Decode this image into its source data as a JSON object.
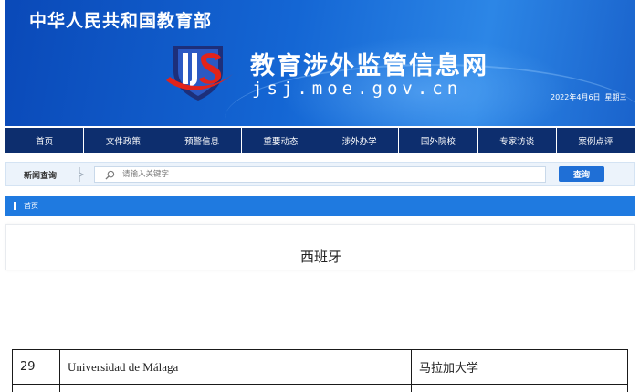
{
  "header": {
    "ministry": "中华人民共和国教育部",
    "site_title": "教育涉外监管信息网",
    "site_domain": "jsj.moe.gov.cn",
    "date": "2022年4月6日",
    "weekday": "星期三",
    "logo_icon": "jsj-shield-logo-icon",
    "colors": {
      "banner": "#1466d4",
      "logo_red": "#e2231a",
      "logo_navy": "#1d2f7a"
    }
  },
  "nav": {
    "items": [
      {
        "label": "首页"
      },
      {
        "label": "文件政策"
      },
      {
        "label": "预警信息"
      },
      {
        "label": "重要动态"
      },
      {
        "label": "涉外办学"
      },
      {
        "label": "国外院校"
      },
      {
        "label": "专家访谈"
      },
      {
        "label": "案例点评"
      }
    ],
    "color": "#0d2e6e"
  },
  "search": {
    "label": "新闻查询",
    "placeholder": "请输入关键字",
    "button": "查询",
    "icon": "search-icon"
  },
  "breadcrumb": {
    "home": "首页"
  },
  "page": {
    "title": "西班牙"
  },
  "table": {
    "rows": [
      {
        "num": "29",
        "name": "Universidad de Málaga",
        "name_cn": "马拉加大学"
      }
    ]
  }
}
